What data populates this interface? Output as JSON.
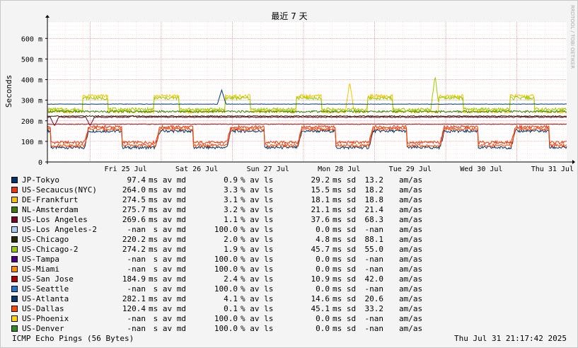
{
  "chart_data": {
    "type": "line",
    "title": "最近 7 天",
    "ylabel": "Seconds",
    "watermark": "RRDTOOL / TOBI OETIKER",
    "ylim": [
      0,
      680
    ],
    "yticks": [
      0,
      100,
      200,
      300,
      400,
      500,
      600
    ],
    "ytick_labels": [
      "0",
      "100 m",
      "200 m",
      "300 m",
      "400 m",
      "500 m",
      "600 m"
    ],
    "xlim": [
      0,
      7.3
    ],
    "xtick_labels": [
      "Fri 25 Jul",
      "Sat 26 Jul",
      "Sun 27 Jul",
      "Mon 28 Jul",
      "Tue 29 Jul",
      "Wed 30 Jul",
      "Thu 31 Jul"
    ],
    "grid": true,
    "series": [
      {
        "name": "JP-Tokyo",
        "color": "#00356b",
        "profile": "cycle",
        "hi": 150,
        "lo": 70,
        "spikes": []
      },
      {
        "name": "US-Secaucus(NYC)",
        "color": "#e8380d",
        "profile": "cycle",
        "hi": 170,
        "lo": 95,
        "spikes": []
      },
      {
        "name": "DE-Frankfurt",
        "color": "#f5c400",
        "profile": "plateau",
        "hi": 320,
        "lo": 245,
        "spikes": [
          [
            4.25,
            390
          ]
        ]
      },
      {
        "name": "NL-Amsterdam",
        "color": "#3a7d00",
        "profile": "flat",
        "hi": 250,
        "lo": 240,
        "spikes": []
      },
      {
        "name": "US-Los Angeles",
        "color": "#7b0030",
        "profile": "flat",
        "hi": 220,
        "lo": 215,
        "spikes": [
          [
            0.1,
            175
          ],
          [
            0.6,
            175
          ],
          [
            1.2,
            225
          ]
        ]
      },
      {
        "name": "US-Los Angeles-2",
        "color": "#a8d0f0",
        "profile": "none",
        "hi": 0,
        "lo": 0,
        "spikes": []
      },
      {
        "name": "US-Chicago",
        "color": "#2b2b00",
        "profile": "flat",
        "hi": 225,
        "lo": 220,
        "spikes": []
      },
      {
        "name": "US-Chicago-2",
        "color": "#9ccc00",
        "profile": "plateau",
        "hi": 310,
        "lo": 255,
        "spikes": [
          [
            5.45,
            420
          ]
        ]
      },
      {
        "name": "US-Tampa",
        "color": "#4b0082",
        "profile": "none",
        "hi": 0,
        "lo": 0,
        "spikes": []
      },
      {
        "name": "US-Miami",
        "color": "#ff8c00",
        "profile": "none",
        "hi": 0,
        "lo": 0,
        "spikes": []
      },
      {
        "name": "US-San Jose",
        "color": "#b00000",
        "profile": "flat",
        "hi": 185,
        "lo": 182,
        "spikes": []
      },
      {
        "name": "US-Seattle",
        "color": "#1e78c8",
        "profile": "none",
        "hi": 0,
        "lo": 0,
        "spikes": []
      },
      {
        "name": "US-Atlanta",
        "color": "#003a70",
        "profile": "flat",
        "hi": 282,
        "lo": 280,
        "spikes": [
          [
            2.45,
            350
          ]
        ]
      },
      {
        "name": "US-Dallas",
        "color": "#ff4500",
        "profile": "cycle",
        "hi": 160,
        "lo": 80,
        "spikes": []
      },
      {
        "name": "US-Phoenix",
        "color": "#ffd700",
        "profile": "none",
        "hi": 0,
        "lo": 0,
        "spikes": []
      },
      {
        "name": "US-Denver",
        "color": "#2e8b22",
        "profile": "none",
        "hi": 0,
        "lo": 0,
        "spikes": []
      }
    ]
  },
  "legend": {
    "unit_median": "ms av md",
    "unit_median_nan": " s av md",
    "unit_loss": "% av ls",
    "unit_avg": "ms sd",
    "unit_amas": "am/as",
    "rows": [
      {
        "name": "JP-Tokyo",
        "median": "97.4",
        "nan": false,
        "loss": "0.9",
        "avg": "29.2",
        "sd": "13.2"
      },
      {
        "name": "US-Secaucus(NYC)",
        "median": "264.0",
        "nan": false,
        "loss": "3.3",
        "avg": "15.5",
        "sd": "18.2"
      },
      {
        "name": "DE-Frankfurt",
        "median": "274.5",
        "nan": false,
        "loss": "3.1",
        "avg": "18.1",
        "sd": "18.8"
      },
      {
        "name": "NL-Amsterdam",
        "median": "275.7",
        "nan": false,
        "loss": "3.2",
        "avg": "21.1",
        "sd": "21.4"
      },
      {
        "name": "US-Los Angeles",
        "median": "269.6",
        "nan": false,
        "loss": "1.1",
        "avg": "37.6",
        "sd": "68.3"
      },
      {
        "name": "US-Los Angeles-2",
        "median": "-nan",
        "nan": true,
        "loss": "100.0",
        "avg": "0.0",
        "sd": "-nan"
      },
      {
        "name": "US-Chicago",
        "median": "220.2",
        "nan": false,
        "loss": "2.0",
        "avg": "4.8",
        "sd": "88.1"
      },
      {
        "name": "US-Chicago-2",
        "median": "274.2",
        "nan": false,
        "loss": "1.9",
        "avg": "45.7",
        "sd": "55.0"
      },
      {
        "name": "US-Tampa",
        "median": "-nan",
        "nan": true,
        "loss": "100.0",
        "avg": "0.0",
        "sd": "-nan"
      },
      {
        "name": "US-Miami",
        "median": "-nan",
        "nan": true,
        "loss": "100.0",
        "avg": "0.0",
        "sd": "-nan"
      },
      {
        "name": "US-San Jose",
        "median": "184.9",
        "nan": false,
        "loss": "2.4",
        "avg": "10.9",
        "sd": "42.0"
      },
      {
        "name": "US-Seattle",
        "median": "-nan",
        "nan": true,
        "loss": "100.0",
        "avg": "0.0",
        "sd": "-nan"
      },
      {
        "name": "US-Atlanta",
        "median": "282.1",
        "nan": false,
        "loss": "4.1",
        "avg": "14.6",
        "sd": "20.6"
      },
      {
        "name": "US-Dallas",
        "median": "120.4",
        "nan": false,
        "loss": "0.1",
        "avg": "45.1",
        "sd": "33.2"
      },
      {
        "name": "US-Phoenix",
        "median": "-nan",
        "nan": true,
        "loss": "100.0",
        "avg": "0.0",
        "sd": "-nan"
      },
      {
        "name": "US-Denver",
        "median": "-nan",
        "nan": true,
        "loss": "100.0",
        "avg": "0.0",
        "sd": "-nan"
      }
    ]
  },
  "footer": {
    "left": "ICMP Echo Pings (56 Bytes)",
    "right": "Thu Jul 31 21:17:42 2025"
  }
}
